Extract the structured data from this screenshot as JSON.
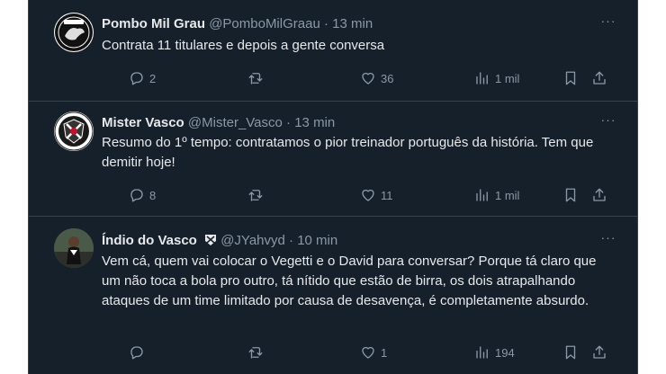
{
  "tweets": [
    {
      "name": "Pombo Mil Grau",
      "handle": "@PomboMilGraau",
      "sep": "·",
      "time": "13 min",
      "text": "Contrata 11 titulares e depois a gente conversa",
      "replies": "2",
      "retweets": "",
      "likes": "36",
      "views": "1 mil"
    },
    {
      "name": "Mister Vasco",
      "handle": "@Mister_Vasco",
      "sep": "·",
      "time": "13 min",
      "text": "Resumo do 1º tempo: contratamos o pior treinador português da história. Tem que demitir hoje!",
      "replies": "8",
      "retweets": "",
      "likes": "11",
      "views": "1 mil"
    },
    {
      "name": "Índio do Vasco",
      "handle": "@JYahvyd",
      "sep": "·",
      "time": "10 min",
      "text": "Vem cá, quem vai colocar o Vegetti e o David para conversar? Porque tá claro que um não toca a bola pro outro, tá nítido que estão de birra, os dois atrapalhando ataques de um time limitado por causa de desavença, é completamente absurdo.",
      "replies": "",
      "retweets": "",
      "likes": "1",
      "views": "194"
    }
  ],
  "colors": {
    "background": "#15202b",
    "border": "#38444d",
    "primary_text": "#e7e9ea",
    "secondary_text": "#8b98a5"
  },
  "icons": [
    "reply-icon",
    "retweet-icon",
    "like-icon",
    "views-icon",
    "bookmark-icon",
    "share-icon",
    "more-icon"
  ]
}
